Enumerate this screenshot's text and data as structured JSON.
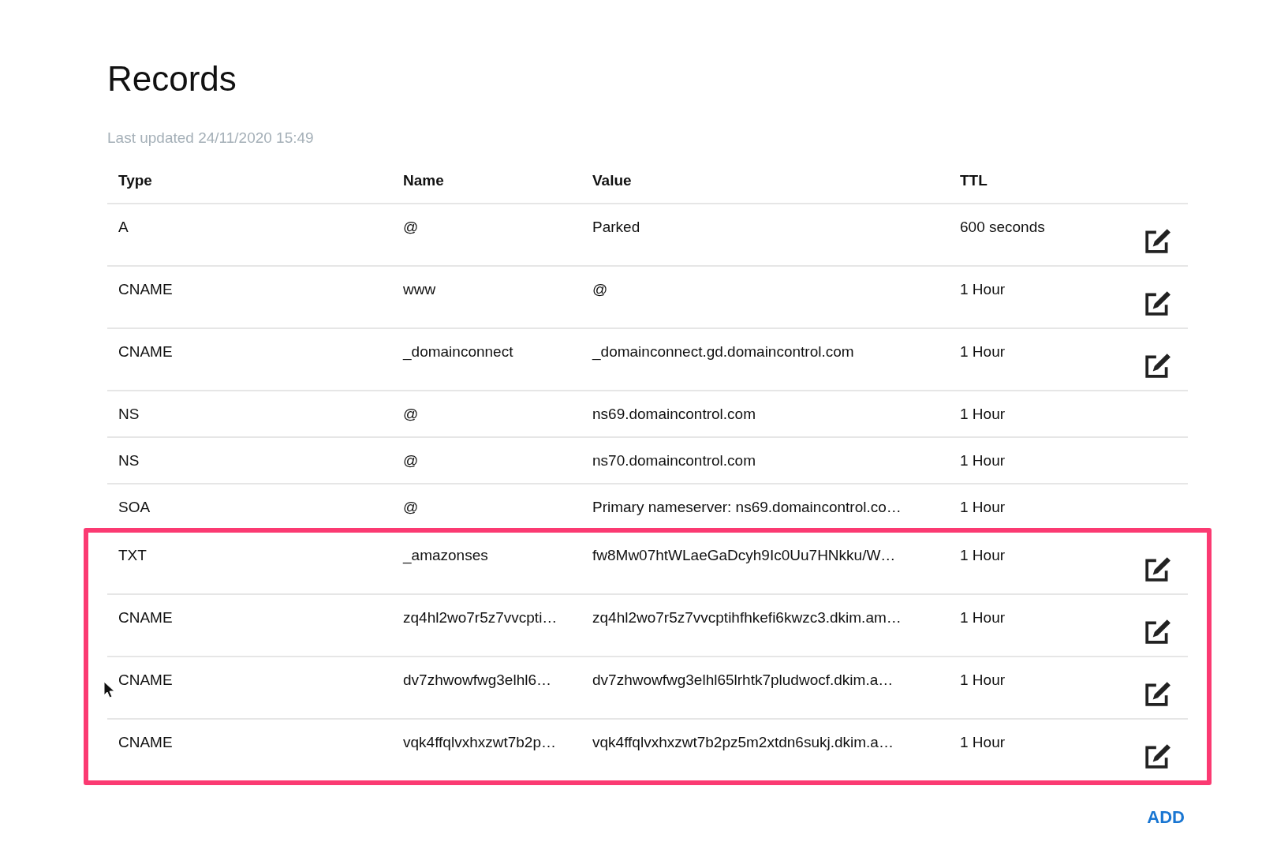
{
  "title": "Records",
  "last_updated": "Last updated 24/11/2020 15:49",
  "table": {
    "columns": [
      "Type",
      "Name",
      "Value",
      "TTL"
    ],
    "rows": [
      {
        "type": "A",
        "name": "@",
        "value": "Parked",
        "ttl": "600 seconds",
        "editable": true,
        "highlighted": false
      },
      {
        "type": "CNAME",
        "name": "www",
        "value": "@",
        "ttl": "1 Hour",
        "editable": true,
        "highlighted": false
      },
      {
        "type": "CNAME",
        "name": "_domainconnect",
        "value": "_domainconnect.gd.domaincontrol.com",
        "ttl": "1 Hour",
        "editable": true,
        "highlighted": false
      },
      {
        "type": "NS",
        "name": "@",
        "value": "ns69.domaincontrol.com",
        "ttl": "1 Hour",
        "editable": false,
        "highlighted": false
      },
      {
        "type": "NS",
        "name": "@",
        "value": "ns70.domaincontrol.com",
        "ttl": "1 Hour",
        "editable": false,
        "highlighted": false
      },
      {
        "type": "SOA",
        "name": "@",
        "value": "Primary nameserver: ns69.domaincontrol.co…",
        "ttl": "1 Hour",
        "editable": false,
        "highlighted": false
      },
      {
        "type": "TXT",
        "name": "_amazonses",
        "value": "fw8Mw07htWLaeGaDcyh9Ic0Uu7HNkku/W…",
        "ttl": "1 Hour",
        "editable": true,
        "highlighted": true
      },
      {
        "type": "CNAME",
        "name": "zq4hl2wo7r5z7vvcpti…",
        "value": "zq4hl2wo7r5z7vvcptihfhkefi6kwzc3.dkim.am…",
        "ttl": "1 Hour",
        "editable": true,
        "highlighted": true
      },
      {
        "type": "CNAME",
        "name": "dv7zhwowfwg3elhl6…",
        "value": "dv7zhwowfwg3elhl65lrhtk7pludwocf.dkim.a…",
        "ttl": "1 Hour",
        "editable": true,
        "highlighted": true
      },
      {
        "type": "CNAME",
        "name": "vqk4ffqlvxhxzwt7b2p…",
        "value": "vqk4ffqlvxhxzwt7b2pz5m2xtdn6sukj.dkim.a…",
        "ttl": "1 Hour",
        "editable": true,
        "highlighted": true
      }
    ]
  },
  "add_button": "ADD"
}
